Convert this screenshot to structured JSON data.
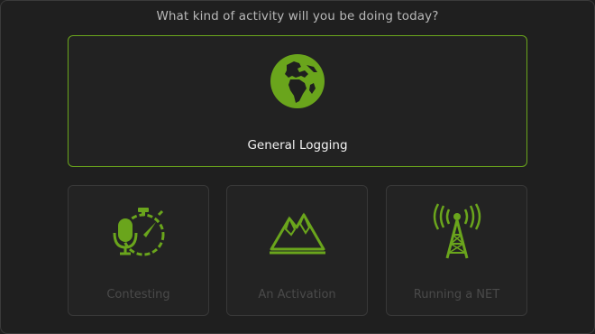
{
  "prompt": "What kind of activity will you be doing today?",
  "colors": {
    "accent": "#6aa51c",
    "background": "#1f1f1f",
    "disabled_text": "#4a4a4a"
  },
  "options": [
    {
      "label": "General Logging",
      "icon": "globe-icon",
      "selected": true
    },
    {
      "label": "Contesting",
      "icon": "microphone-stopwatch-icon",
      "selected": false
    },
    {
      "label": "An Activation",
      "icon": "mountain-icon",
      "selected": false
    },
    {
      "label": "Running a NET",
      "icon": "radio-tower-icon",
      "selected": false
    }
  ]
}
